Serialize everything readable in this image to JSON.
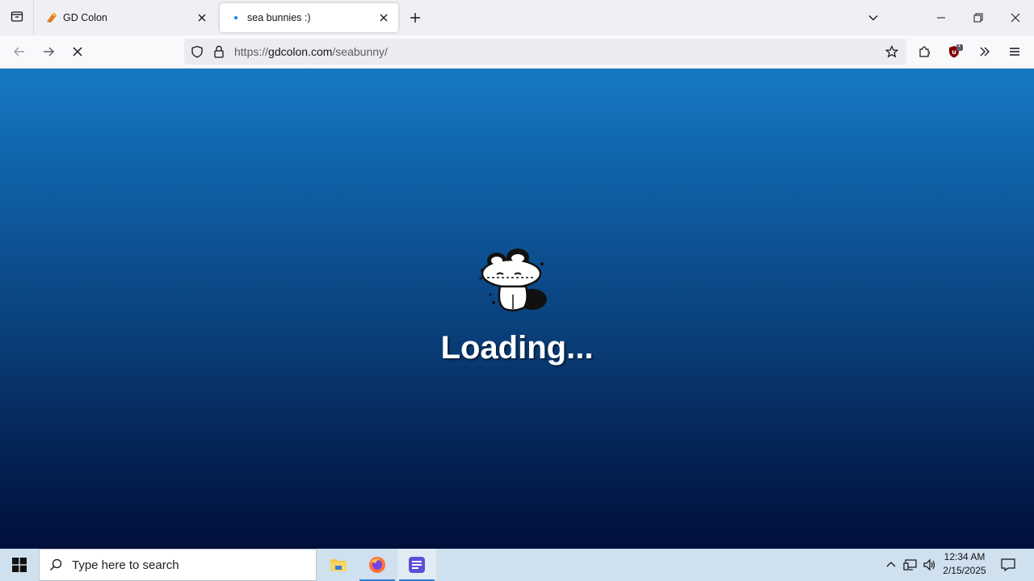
{
  "browser": {
    "tabs": [
      {
        "title": "GD Colon",
        "active": false
      },
      {
        "title": "sea bunnies :)",
        "active": true
      }
    ],
    "url": {
      "prefix": "https://",
      "domain": "gdcolon.com",
      "path": "/seabunny/"
    },
    "extension_badge": "1"
  },
  "page": {
    "loading_text": "Loading..."
  },
  "taskbar": {
    "search_placeholder": "Type here to search",
    "time": "12:34 AM",
    "date": "2/15/2025"
  },
  "colors": {
    "bg_top": "#1679c4",
    "bg_bottom": "#010f3a",
    "taskbar": "#cfe0ef"
  }
}
